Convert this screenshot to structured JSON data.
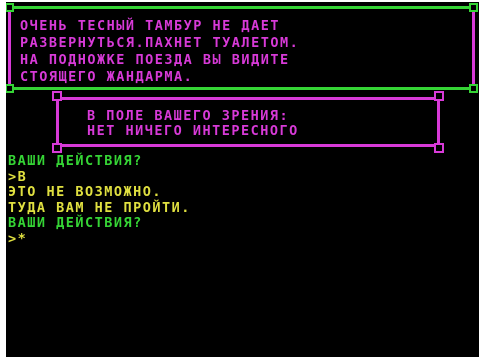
{
  "colors": {
    "background": "#000000",
    "magenta": "#d83ad8",
    "green": "#35d435",
    "yellow": "#e0e040"
  },
  "description": {
    "lines": [
      "ОЧЕНЬ ТЕСНЫЙ ТАМБУР НЕ ДАЕТ",
      "РАЗВЕРНУТЬСЯ.ПАХНЕТ ТУАЛЕТОМ.",
      "НА ПОДНОЖКЕ ПОЕЗДА ВЫ ВИДИТЕ",
      "СТОЯЩЕГО ЖАНДАРМА."
    ]
  },
  "view": {
    "lines": [
      "В ПОЛЕ ВАШЕГО ЗРЕНИЯ:",
      "НЕТ НИЧЕГО ИНТЕРЕСНОГО"
    ]
  },
  "console": {
    "prompt1": "ВАШИ ДЕЙСТВИЯ?",
    "input1": ">В",
    "response1": "ЭТО НЕ ВОЗМОЖНО.",
    "response2": "ТУДА ВАМ НЕ ПРОЙТИ.",
    "prompt2": "ВАШИ ДЕЙСТВИЯ?",
    "input2": ">*"
  }
}
